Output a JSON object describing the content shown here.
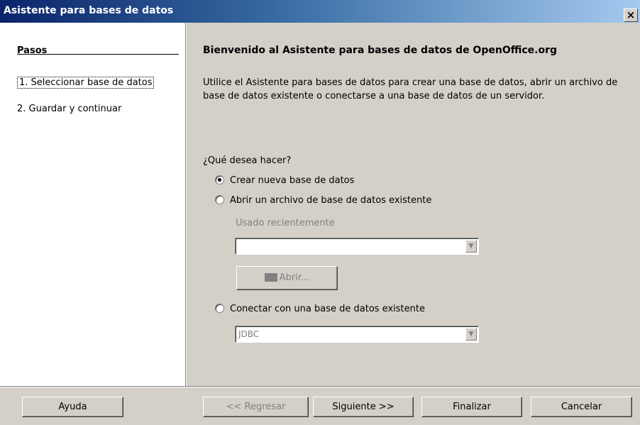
{
  "window": {
    "title": "Asistente para bases de datos",
    "close_glyph": "×"
  },
  "sidebar": {
    "title": "Pasos",
    "steps": [
      {
        "label": "1.  Seleccionar base de datos"
      },
      {
        "label": "2.  Guardar y continuar"
      }
    ]
  },
  "main": {
    "heading": "Bienvenido al Asistente para bases de datos de OpenOffice.org",
    "intro": "Utilice el Asistente para bases de datos para crear una base de datos, abrir un archivo de base de datos existente o conectarse a una base de datos de un servidor.",
    "question": "¿Qué desea hacer?",
    "options": [
      {
        "label": "Crear nueva base de datos",
        "selected": true
      },
      {
        "label": "Abrir un archivo de base de datos existente",
        "selected": false
      },
      {
        "label": "Conectar con una base de datos existente",
        "selected": false
      }
    ],
    "recent_label": "Usado recientemente",
    "recent_value": "",
    "open_button": "Abrir...",
    "connection_type": "JDBC"
  },
  "footer": {
    "help": "Ayuda",
    "back": "<< Regresar",
    "next": "Siguiente >>",
    "finish": "Finalizar",
    "cancel": "Cancelar"
  },
  "icons": {
    "close": "close-icon",
    "dropdown": "chevron-down-icon",
    "folder": "folder-open-icon"
  },
  "colors": {
    "titlebar_start": "#0a246a",
    "titlebar_end": "#a6caf0",
    "dialog_bg": "#d4d0c8",
    "disabled_text": "#808080"
  }
}
